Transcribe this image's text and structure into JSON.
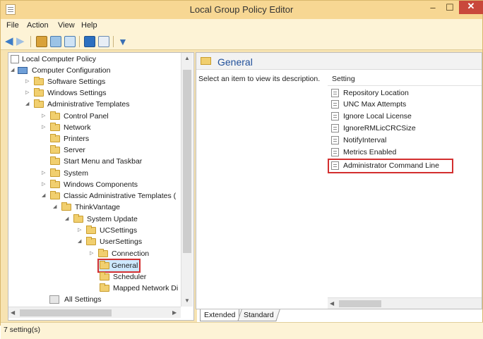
{
  "window": {
    "title": "Local Group Policy Editor",
    "minimize_glyph": "–",
    "maximize_glyph": "☐",
    "close_glyph": "✕"
  },
  "menubar": [
    "File",
    "Action",
    "View",
    "Help"
  ],
  "toolbar": {
    "icons": [
      "back-icon",
      "forward-icon",
      "up-folder-icon",
      "show-hide-tree-icon",
      "export-list-icon",
      "help-icon",
      "properties-icon",
      "filter-icon"
    ]
  },
  "tree": {
    "items": [
      {
        "label": "Local Computer Policy",
        "icon": "policy-icon"
      },
      {
        "label": "Computer Configuration",
        "icon": "computer-icon"
      },
      {
        "label": "Software Settings",
        "icon": "folder-icon"
      },
      {
        "label": "Windows Settings",
        "icon": "folder-icon"
      },
      {
        "label": "Administrative Templates",
        "icon": "folder-icon"
      },
      {
        "label": "Control Panel",
        "icon": "folder-icon"
      },
      {
        "label": "Network",
        "icon": "folder-icon"
      },
      {
        "label": "Printers",
        "icon": "folder-icon"
      },
      {
        "label": "Server",
        "icon": "folder-icon"
      },
      {
        "label": "Start Menu and Taskbar",
        "icon": "folder-icon"
      },
      {
        "label": "System",
        "icon": "folder-icon"
      },
      {
        "label": "Windows Components",
        "icon": "folder-icon"
      },
      {
        "label": "Classic Administrative Templates (",
        "icon": "folder-icon"
      },
      {
        "label": "ThinkVantage",
        "icon": "folder-icon"
      },
      {
        "label": "System Update",
        "icon": "folder-icon"
      },
      {
        "label": "UCSettings",
        "icon": "folder-icon"
      },
      {
        "label": "UserSettings",
        "icon": "folder-icon"
      },
      {
        "label": "Connection",
        "icon": "folder-icon"
      },
      {
        "label": "General",
        "icon": "folder-icon"
      },
      {
        "label": "Scheduler",
        "icon": "folder-icon"
      },
      {
        "label": "Mapped Network Di",
        "icon": "folder-icon"
      },
      {
        "label": "All Settings",
        "icon": "all-settings-icon"
      }
    ],
    "selected": "General"
  },
  "right": {
    "title": "General",
    "description": "Select an item to view its description.",
    "column_header": "Setting",
    "settings": [
      "Repository Location",
      "UNC Max Attempts",
      "Ignore Local License",
      "IgnoreRMLicCRCSize",
      "NotifyInterval",
      "Metrics Enabled",
      "Administrator Command Line"
    ],
    "highlighted": "Administrator Command Line"
  },
  "tabs": [
    "Extended",
    "Standard"
  ],
  "status": "7 setting(s)",
  "colors": {
    "title_bg": "#f7d793",
    "highlight_red": "#d32f2f",
    "folder_yellow": "#f1cf6f",
    "header_blue": "#1f4f9a"
  }
}
